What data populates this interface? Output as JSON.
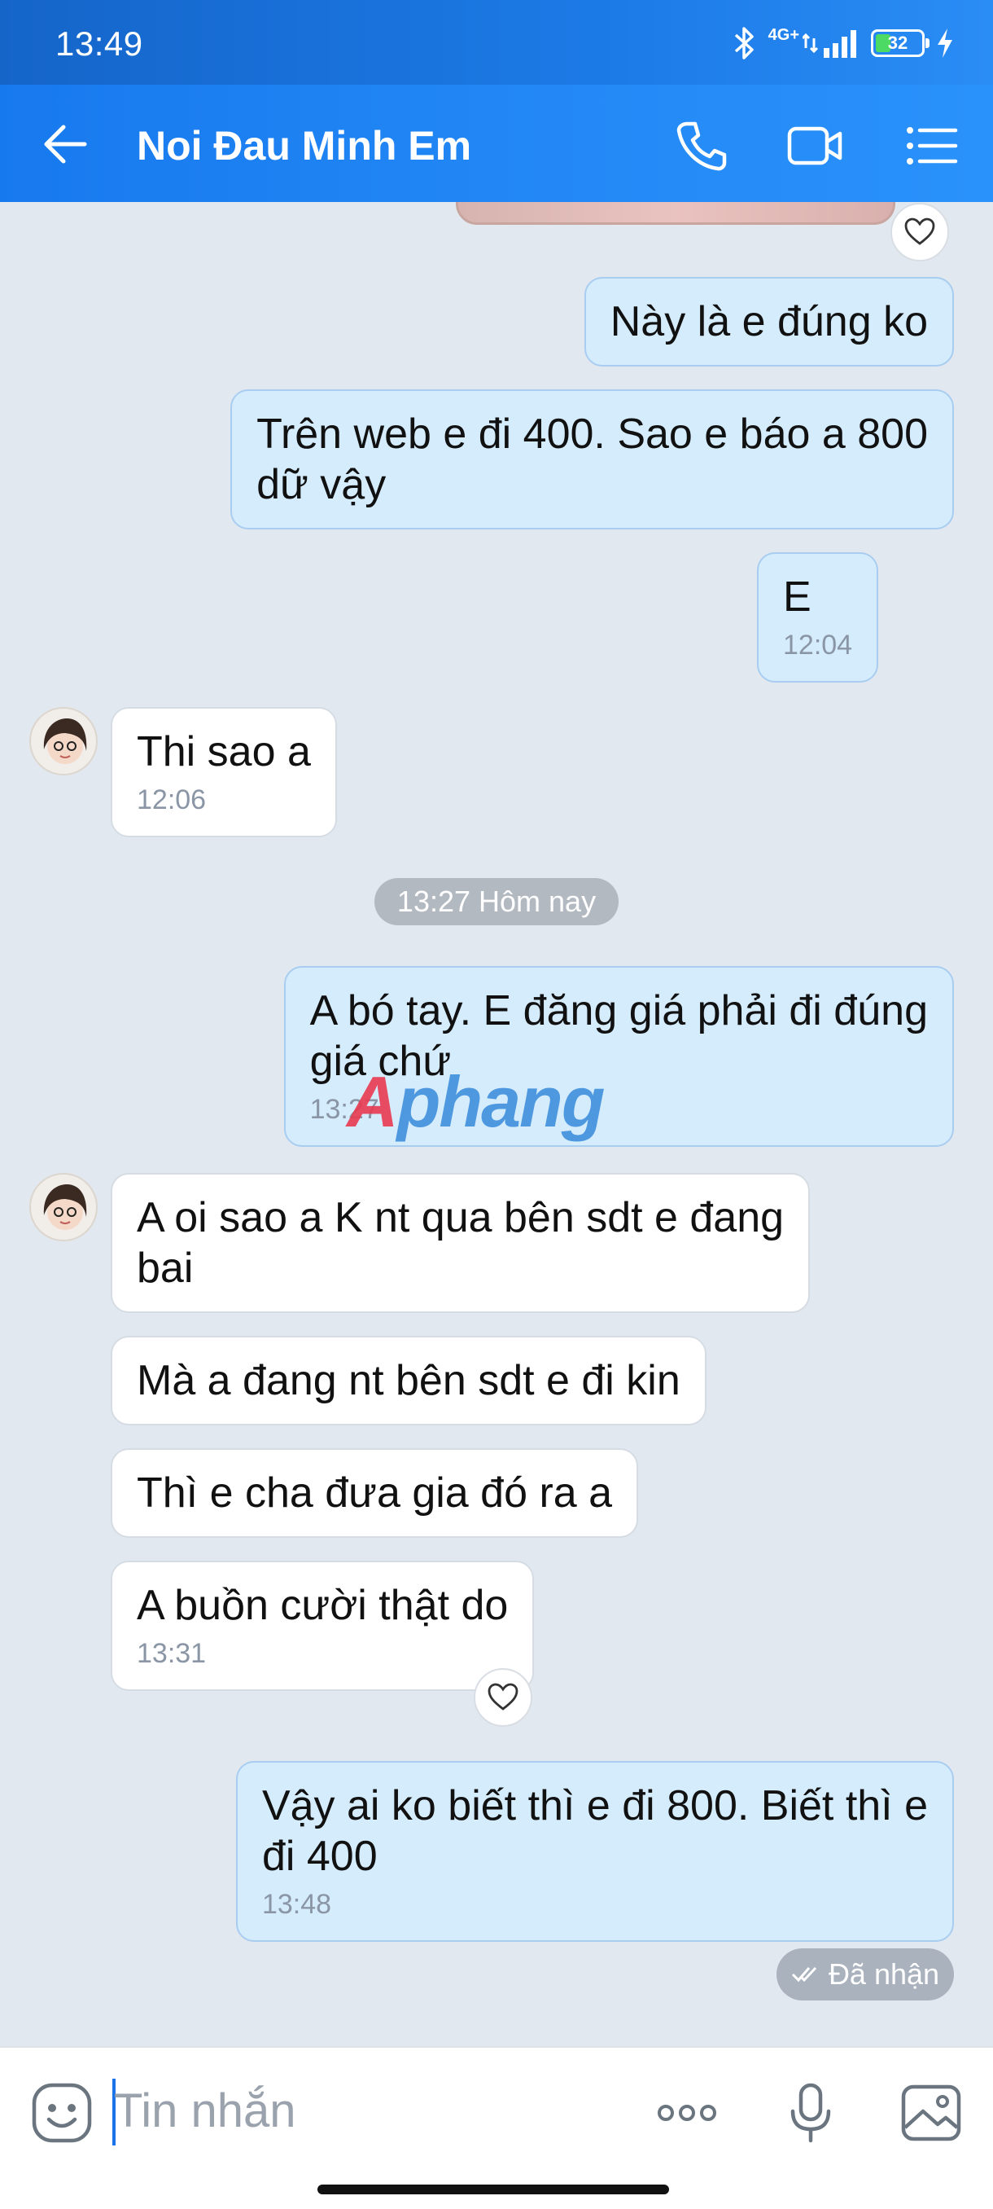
{
  "status_bar": {
    "time": "13:49",
    "network": "4G+",
    "battery": "32"
  },
  "header": {
    "title": "Noi Đau Minh Em"
  },
  "messages": [
    {
      "text": "Này là e đúng ko"
    },
    {
      "line1": "Trên web e đi 400. Sao e báo a 800",
      "line2": "dữ vậy"
    },
    {
      "text": "E",
      "time": "12:04"
    },
    {
      "text": "Thi sao a",
      "time": "12:06"
    },
    {
      "line1": "A bó tay. E đăng giá phải đi đúng",
      "line2": "giá chứ",
      "time": "13:27"
    },
    {
      "line1": "A oi sao a K nt qua bên sdt e đang",
      "line2": "bai"
    },
    {
      "text": "Mà a đang nt bên sdt e đi kin"
    },
    {
      "text": "Thì e cha đưa gia đó  ra a"
    },
    {
      "text": "A buồn cười thật do",
      "time": "13:31"
    },
    {
      "line1": "Vậy ai ko biết thì e đi 800. Biết thì e",
      "line2": "đi 400",
      "time": "13:48"
    }
  ],
  "date_separator": "13:27 Hôm nay",
  "delivery_status": "Đã nhận",
  "watermark": {
    "first": "A",
    "rest": "phang"
  },
  "input": {
    "placeholder": "Tin nhắn"
  },
  "colors": {
    "header": "#1779ee",
    "outgoing_bubble": "#d5ecfd",
    "incoming_bubble": "#ffffff",
    "background": "#e2e8ef"
  },
  "icons": [
    "back-arrow-icon",
    "phone-icon",
    "video-call-icon",
    "menu-list-icon",
    "heart-icon",
    "emoji-icon",
    "more-icon",
    "microphone-icon",
    "image-icon",
    "check-icon",
    "bluetooth-icon",
    "signal-icon",
    "battery-icon",
    "charging-icon"
  ]
}
